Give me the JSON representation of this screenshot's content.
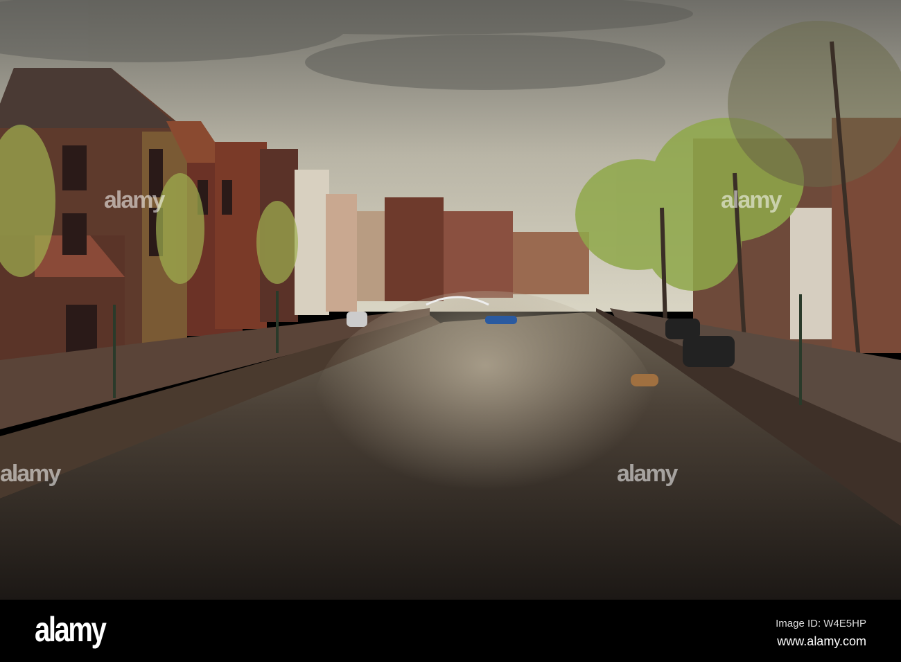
{
  "footer": {
    "logo": "alamy",
    "image_id": "Image ID: W4E5HP",
    "site": "www.alamy.com"
  },
  "watermark": "alamy",
  "colors": {
    "sky": "#c9c5b5",
    "water": "#2a2420",
    "brick": "#6b3a2a",
    "foliage": "#8fa84a"
  }
}
